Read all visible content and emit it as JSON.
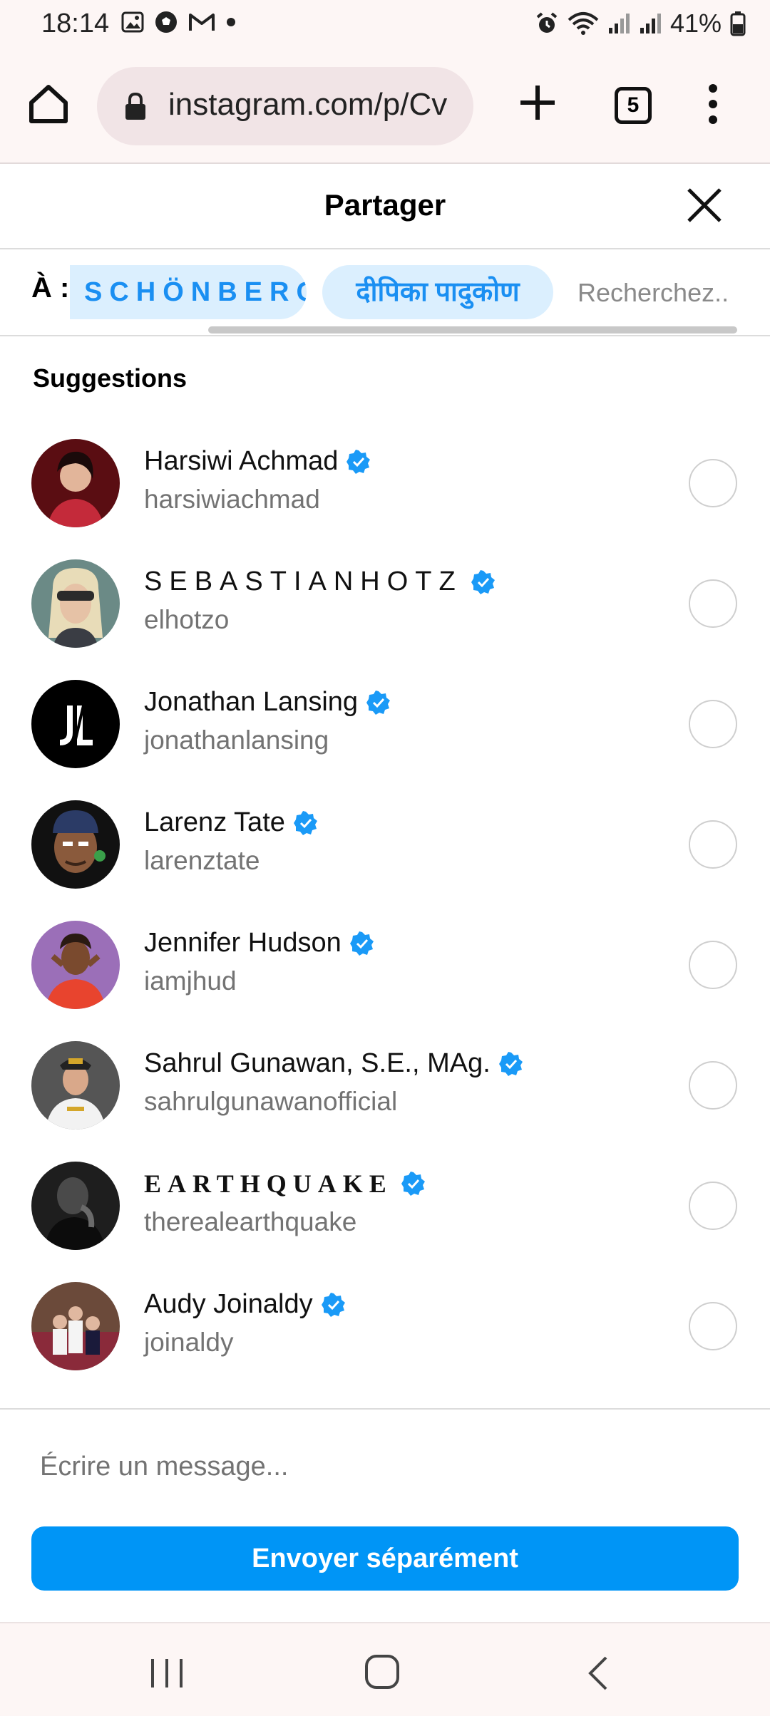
{
  "status_bar": {
    "time": "18:14",
    "battery": "41%",
    "left_icons": [
      "gallery-icon",
      "soccer-ball-icon",
      "gmail-icon",
      "dot-icon"
    ],
    "right_icons": [
      "alarm-icon",
      "wifi-icon",
      "signal-icon",
      "signal-icon",
      "battery-icon"
    ]
  },
  "browser": {
    "url": "instagram.com/p/Cv",
    "tab_count": "5"
  },
  "share": {
    "title": "Partager",
    "to_label": "À :",
    "chips": [
      "SCHÖNBERG",
      "दीपिका पादुकोण"
    ],
    "search_placeholder": "Recherchez..",
    "suggestions_title": "Suggestions",
    "items": [
      {
        "name": "Harsiwi Achmad",
        "handle": "harsiwiachmad",
        "verified": true
      },
      {
        "name": "SEBASTIANHOTZ",
        "handle": "elhotzo",
        "verified": true
      },
      {
        "name": "Jonathan Lansing",
        "handle": "jonathanlansing",
        "verified": true
      },
      {
        "name": "Larenz Tate",
        "handle": "larenztate",
        "verified": true
      },
      {
        "name": "Jennifer Hudson",
        "handle": "iamjhud",
        "verified": true
      },
      {
        "name": "Sahrul Gunawan, S.E., MAg.",
        "handle": "sahrulgunawanofficial",
        "verified": true
      },
      {
        "name": "EARTHQUAKE",
        "handle": "therealearthquake",
        "verified": true
      },
      {
        "name": "Audy Joinaldy",
        "handle": "joinaldy",
        "verified": true
      }
    ],
    "message_placeholder": "Écrire un message...",
    "send_label": "Envoyer séparément"
  },
  "colors": {
    "accent": "#0095f6",
    "chip_bg": "#dbeffe",
    "chip_text": "#1a8ff2",
    "verified": "#1a9af7",
    "secondary_text": "#737373"
  }
}
